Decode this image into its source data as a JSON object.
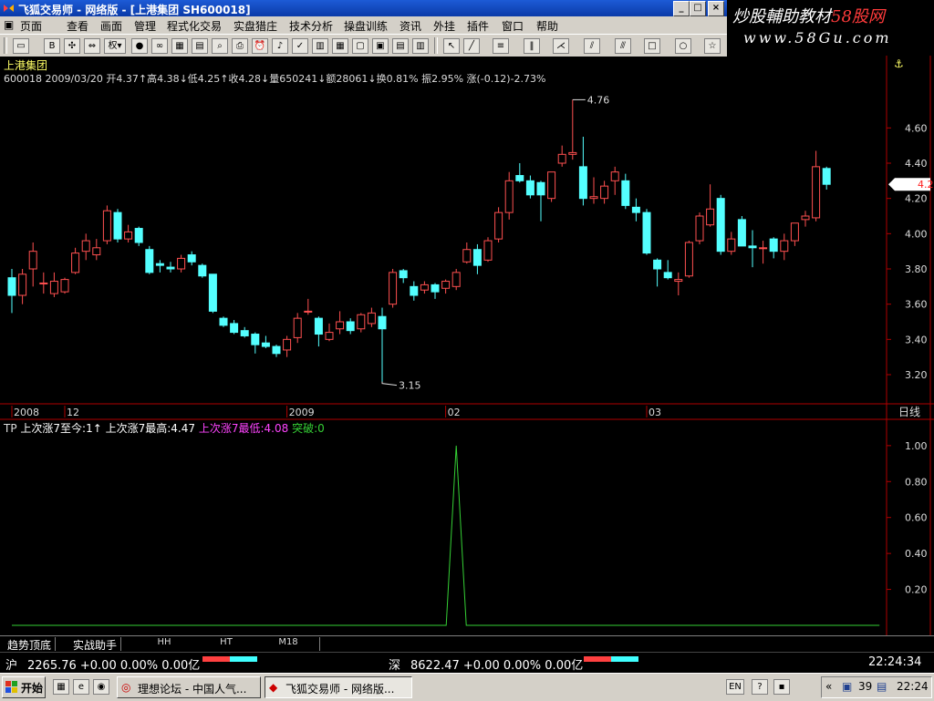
{
  "window": {
    "title": "飞狐交易师 - 网络版 - [上港集团 SH600018]"
  },
  "watermark": {
    "line1_prefix": "炒股輔助教材",
    "line1_accent": "58股网",
    "line2": "www.58Gu.com"
  },
  "menu": [
    "页面",
    "查看",
    "画面",
    "管理",
    "程式化交易",
    "实盘猎庄",
    "技术分析",
    "操盘训练",
    "资讯",
    "外挂",
    "插件",
    "窗口",
    "帮助"
  ],
  "toolbar": {
    "quan_label": "权",
    "items": [
      "folder-icon",
      "bsi-icon",
      "arrows-icon",
      "swap-icon",
      "weight-icon",
      "glasses-icon",
      "grid-icon",
      "book-icon",
      "search-icon",
      "printer-icon",
      "alarm-icon",
      "bell-icon",
      "check-icon",
      "calendar-icon",
      "table-icon",
      "window-icon",
      "chart-icon",
      "tile-icon",
      "cursor-icon",
      "line-icon",
      "ray-icon",
      "hlines-icon",
      "vlines-icon",
      "fan-icon",
      "channel-icon",
      "gann-icon",
      "rect-icon",
      "circle-icon",
      "star-icon"
    ]
  },
  "stock": {
    "name": "上港集团",
    "info": "600018 2009/03/20 开4.37↑高4.38↓低4.25↑收4.28↓量650241↓额28061↓换0.81% 振2.95% 涨(-0.12)-2.73%",
    "last_price": "4.28",
    "high_marker": "4.76",
    "low_marker": "3.15",
    "period": "日线",
    "colors": {
      "up": "#ff5050",
      "down": "#54ffff",
      "axis": "#b00000",
      "text": "#dcdcdc"
    }
  },
  "chart_data": [
    {
      "type": "candlestick",
      "title": "",
      "ylim": [
        3.05,
        4.85
      ],
      "yticks": [
        3.2,
        3.4,
        3.6,
        3.8,
        4.0,
        4.2,
        4.4,
        4.6
      ],
      "x_labels": [
        {
          "label": "2008",
          "index": 0
        },
        {
          "label": "12",
          "index": 5
        },
        {
          "label": "2009",
          "index": 26
        },
        {
          "label": "02",
          "index": 41
        },
        {
          "label": "03",
          "index": 60
        }
      ],
      "ohlc": [
        {
          "o": 3.75,
          "h": 3.8,
          "l": 3.55,
          "c": 3.65
        },
        {
          "o": 3.65,
          "h": 3.8,
          "l": 3.6,
          "c": 3.77
        },
        {
          "o": 3.8,
          "h": 3.95,
          "l": 3.7,
          "c": 3.9
        },
        {
          "o": 3.72,
          "h": 3.78,
          "l": 3.66,
          "c": 3.72
        },
        {
          "o": 3.66,
          "h": 3.78,
          "l": 3.64,
          "c": 3.73
        },
        {
          "o": 3.67,
          "h": 3.75,
          "l": 3.66,
          "c": 3.74
        },
        {
          "o": 3.78,
          "h": 3.92,
          "l": 3.77,
          "c": 3.89
        },
        {
          "o": 3.9,
          "h": 4.0,
          "l": 3.85,
          "c": 3.96
        },
        {
          "o": 3.88,
          "h": 3.97,
          "l": 3.85,
          "c": 3.92
        },
        {
          "o": 3.96,
          "h": 4.16,
          "l": 3.94,
          "c": 4.13
        },
        {
          "o": 4.12,
          "h": 4.14,
          "l": 3.95,
          "c": 3.97
        },
        {
          "o": 3.97,
          "h": 4.05,
          "l": 3.95,
          "c": 4.01
        },
        {
          "o": 4.03,
          "h": 4.04,
          "l": 3.93,
          "c": 3.95
        },
        {
          "o": 3.91,
          "h": 3.93,
          "l": 3.77,
          "c": 3.78
        },
        {
          "o": 3.83,
          "h": 3.85,
          "l": 3.78,
          "c": 3.82
        },
        {
          "o": 3.81,
          "h": 3.84,
          "l": 3.78,
          "c": 3.8
        },
        {
          "o": 3.8,
          "h": 3.88,
          "l": 3.78,
          "c": 3.86
        },
        {
          "o": 3.88,
          "h": 3.9,
          "l": 3.82,
          "c": 3.84
        },
        {
          "o": 3.82,
          "h": 3.83,
          "l": 3.75,
          "c": 3.76
        },
        {
          "o": 3.77,
          "h": 3.77,
          "l": 3.55,
          "c": 3.56
        },
        {
          "o": 3.52,
          "h": 3.53,
          "l": 3.47,
          "c": 3.48
        },
        {
          "o": 3.49,
          "h": 3.51,
          "l": 3.43,
          "c": 3.44
        },
        {
          "o": 3.45,
          "h": 3.47,
          "l": 3.41,
          "c": 3.42
        },
        {
          "o": 3.43,
          "h": 3.44,
          "l": 3.32,
          "c": 3.37
        },
        {
          "o": 3.38,
          "h": 3.42,
          "l": 3.35,
          "c": 3.36
        },
        {
          "o": 3.36,
          "h": 3.37,
          "l": 3.3,
          "c": 3.32
        },
        {
          "o": 3.34,
          "h": 3.42,
          "l": 3.3,
          "c": 3.4
        },
        {
          "o": 3.41,
          "h": 3.55,
          "l": 3.38,
          "c": 3.52
        },
        {
          "o": 3.56,
          "h": 3.63,
          "l": 3.54,
          "c": 3.56
        },
        {
          "o": 3.52,
          "h": 3.53,
          "l": 3.36,
          "c": 3.43
        },
        {
          "o": 3.4,
          "h": 3.49,
          "l": 3.39,
          "c": 3.44
        },
        {
          "o": 3.46,
          "h": 3.56,
          "l": 3.43,
          "c": 3.5
        },
        {
          "o": 3.5,
          "h": 3.52,
          "l": 3.43,
          "c": 3.45
        },
        {
          "o": 3.46,
          "h": 3.55,
          "l": 3.44,
          "c": 3.54
        },
        {
          "o": 3.49,
          "h": 3.58,
          "l": 3.47,
          "c": 3.55
        },
        {
          "o": 3.53,
          "h": 3.58,
          "l": 3.15,
          "c": 3.46
        },
        {
          "o": 3.6,
          "h": 3.8,
          "l": 3.58,
          "c": 3.78
        },
        {
          "o": 3.79,
          "h": 3.8,
          "l": 3.72,
          "c": 3.75
        },
        {
          "o": 3.7,
          "h": 3.73,
          "l": 3.62,
          "c": 3.65
        },
        {
          "o": 3.68,
          "h": 3.73,
          "l": 3.66,
          "c": 3.71
        },
        {
          "o": 3.71,
          "h": 3.72,
          "l": 3.63,
          "c": 3.67
        },
        {
          "o": 3.69,
          "h": 3.74,
          "l": 3.66,
          "c": 3.73
        },
        {
          "o": 3.7,
          "h": 3.8,
          "l": 3.68,
          "c": 3.78
        },
        {
          "o": 3.84,
          "h": 3.95,
          "l": 3.83,
          "c": 3.91
        },
        {
          "o": 3.91,
          "h": 3.94,
          "l": 3.77,
          "c": 3.82
        },
        {
          "o": 3.85,
          "h": 3.98,
          "l": 3.84,
          "c": 3.96
        },
        {
          "o": 3.97,
          "h": 4.15,
          "l": 3.95,
          "c": 4.12
        },
        {
          "o": 4.12,
          "h": 4.35,
          "l": 4.08,
          "c": 4.3
        },
        {
          "o": 4.33,
          "h": 4.4,
          "l": 4.29,
          "c": 4.3
        },
        {
          "o": 4.3,
          "h": 4.33,
          "l": 4.2,
          "c": 4.22
        },
        {
          "o": 4.29,
          "h": 4.3,
          "l": 4.07,
          "c": 4.22
        },
        {
          "o": 4.2,
          "h": 4.35,
          "l": 4.18,
          "c": 4.35
        },
        {
          "o": 4.4,
          "h": 4.5,
          "l": 4.38,
          "c": 4.45
        },
        {
          "o": 4.45,
          "h": 4.76,
          "l": 4.42,
          "c": 4.46
        },
        {
          "o": 4.38,
          "h": 4.55,
          "l": 4.16,
          "c": 4.2
        },
        {
          "o": 4.2,
          "h": 4.32,
          "l": 4.17,
          "c": 4.21
        },
        {
          "o": 4.2,
          "h": 4.3,
          "l": 4.17,
          "c": 4.27
        },
        {
          "o": 4.3,
          "h": 4.38,
          "l": 4.22,
          "c": 4.35
        },
        {
          "o": 4.3,
          "h": 4.34,
          "l": 4.14,
          "c": 4.16
        },
        {
          "o": 4.15,
          "h": 4.2,
          "l": 4.07,
          "c": 4.12
        },
        {
          "o": 4.12,
          "h": 4.14,
          "l": 3.88,
          "c": 3.89
        },
        {
          "o": 3.85,
          "h": 3.86,
          "l": 3.7,
          "c": 3.8
        },
        {
          "o": 3.78,
          "h": 3.85,
          "l": 3.74,
          "c": 3.75
        },
        {
          "o": 3.73,
          "h": 3.78,
          "l": 3.65,
          "c": 3.74
        },
        {
          "o": 3.76,
          "h": 3.96,
          "l": 3.75,
          "c": 3.95
        },
        {
          "o": 3.96,
          "h": 4.12,
          "l": 3.94,
          "c": 4.1
        },
        {
          "o": 4.05,
          "h": 4.28,
          "l": 4.04,
          "c": 4.14
        },
        {
          "o": 4.2,
          "h": 4.22,
          "l": 3.88,
          "c": 3.9
        },
        {
          "o": 3.9,
          "h": 4.01,
          "l": 3.88,
          "c": 3.97
        },
        {
          "o": 4.08,
          "h": 4.1,
          "l": 3.93,
          "c": 3.93
        },
        {
          "o": 3.93,
          "h": 4.02,
          "l": 3.81,
          "c": 3.92
        },
        {
          "o": 3.92,
          "h": 3.96,
          "l": 3.83,
          "c": 3.92
        },
        {
          "o": 3.97,
          "h": 3.98,
          "l": 3.86,
          "c": 3.9
        },
        {
          "o": 3.9,
          "h": 4.0,
          "l": 3.85,
          "c": 3.96
        },
        {
          "o": 3.96,
          "h": 4.06,
          "l": 3.93,
          "c": 4.06
        },
        {
          "o": 4.08,
          "h": 4.13,
          "l": 4.04,
          "c": 4.1
        },
        {
          "o": 4.09,
          "h": 4.47,
          "l": 4.07,
          "c": 4.38
        },
        {
          "o": 4.37,
          "h": 4.38,
          "l": 4.25,
          "c": 4.28
        }
      ]
    },
    {
      "type": "line",
      "title": "",
      "indicator": "TP",
      "ylim": [
        0,
        1.05
      ],
      "yticks": [
        0.2,
        0.4,
        0.6,
        0.8,
        1.0
      ],
      "series": [
        {
          "name": "突破",
          "color": "#35d035",
          "values": [
            0,
            0,
            0,
            0,
            0,
            0,
            0,
            0,
            0,
            0,
            0,
            0,
            0,
            0,
            0,
            0,
            0,
            0,
            0,
            0,
            0,
            0,
            0,
            0,
            0,
            0,
            0,
            0,
            0,
            0,
            0,
            0,
            0,
            0,
            0,
            0,
            0,
            0,
            0,
            0,
            0,
            0,
            0,
            0,
            0,
            0,
            0,
            0,
            0,
            0,
            0,
            0,
            0,
            0,
            0,
            0,
            0,
            0,
            0,
            0,
            0,
            0,
            0,
            0,
            0,
            0,
            0,
            0,
            0,
            0,
            0,
            0,
            0,
            0,
            0,
            0,
            0,
            0,
            0,
            0,
            0,
            0,
            0
          ]
        }
      ],
      "spike_index": 42,
      "legend": [
        {
          "text": "TP",
          "color": "#dcdcdc"
        },
        {
          "text": "上次涨7至今:1↑",
          "color": "#ffffff"
        },
        {
          "text": "上次涨7最高:4.47",
          "color": "#ffffff"
        },
        {
          "text": "上次涨7最低:4.08",
          "color": "#ff44ff"
        },
        {
          "text": "突破:0",
          "color": "#35d035"
        }
      ]
    }
  ],
  "tabs": [
    {
      "label": "趋势顶底"
    },
    {
      "label": "实战助手"
    },
    {
      "label": "HH"
    },
    {
      "label": "HT"
    },
    {
      "label": "M18"
    }
  ],
  "status": {
    "sh_label": "沪",
    "sh_text": "2265.76 +0.00 0.00% 0.00亿",
    "sz_label": "深",
    "sz_text": "8622.47 +0.00 0.00% 0.00亿",
    "time": "22:24:34"
  },
  "taskbar": {
    "start": "开始",
    "items": [
      {
        "label": "理想论坛 - 中国人气...",
        "active": false
      },
      {
        "label": "飞狐交易师 - 网络版...",
        "active": true
      }
    ],
    "lang": "EN",
    "tray_count": "39",
    "clock": "22:24"
  }
}
